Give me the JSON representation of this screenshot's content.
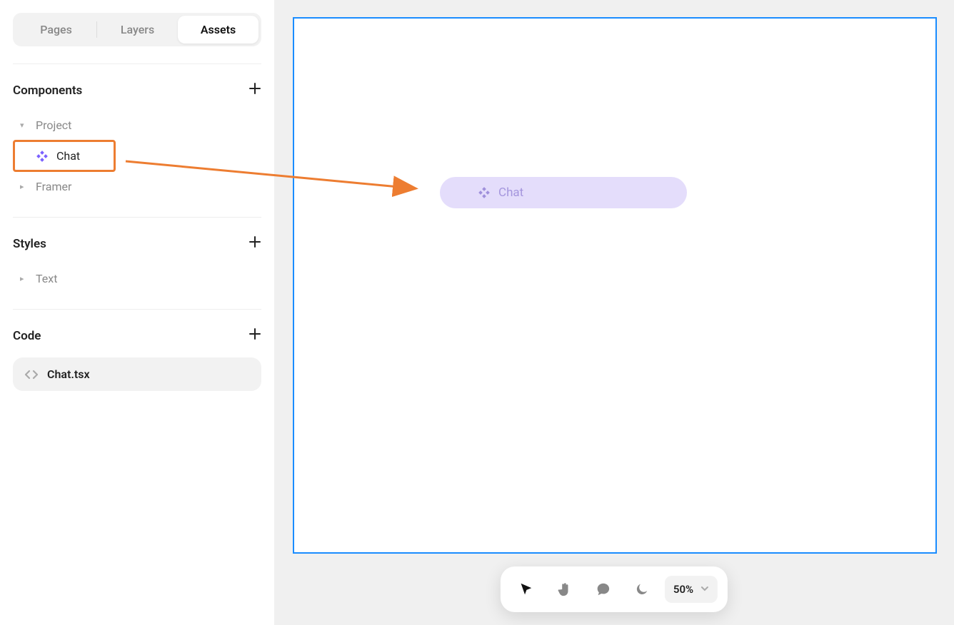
{
  "tabs": {
    "pages": "Pages",
    "layers": "Layers",
    "assets": "Assets",
    "active": "assets"
  },
  "sections": {
    "components": {
      "title": "Components",
      "items": [
        "Project",
        "Chat",
        "Framer"
      ]
    },
    "styles": {
      "title": "Styles",
      "items": [
        "Text"
      ]
    },
    "code": {
      "title": "Code",
      "file": "Chat.tsx"
    }
  },
  "canvas": {
    "chat_label": "Chat"
  },
  "toolbar": {
    "zoom": "50%"
  },
  "colors": {
    "accent": "#7b61ff",
    "annotation": "#ed7d31",
    "selection": "#1a8cff",
    "canvas_bg": "#f0f0f0",
    "drop_bg": "#e4ddfb"
  }
}
